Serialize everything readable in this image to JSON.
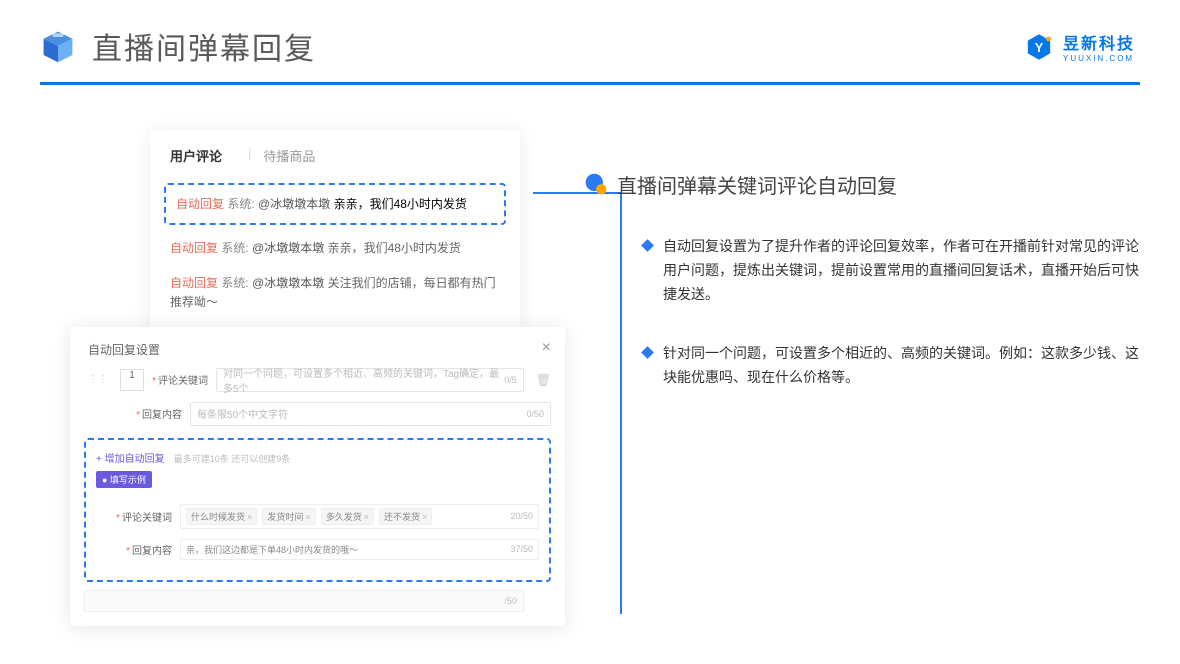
{
  "header": {
    "title": "直播间弹幕回复",
    "brand_cn": "昱新科技",
    "brand_en": "YUUXIN.COM"
  },
  "card1": {
    "tab_active": "用户评论",
    "tab_inactive": "待播商品",
    "highlighted_comment": "自动回复 系统: @冰墩墩本墩 亲亲，我们48小时内发货",
    "auto_label": "自动回复",
    "sys_label": "系统:",
    "name1": "@冰墩墩本墩",
    "text1": "亲亲，我们48小时内发货",
    "name2": "@冰墩墩本墩",
    "text2": "关注我们的店铺，每日都有热门推荐呦～"
  },
  "card2": {
    "title": "自动回复设置",
    "num": "1",
    "label1": "评论关键词",
    "placeholder1": "对同一个问题，可设置多个相近、高频的关键词，Tag确定，最多5个",
    "counter1": "0/5",
    "label2": "回复内容",
    "placeholder2": "每条限50个中文字符",
    "counter2": "0/50",
    "add_link": "+ 增加自动回复",
    "add_hint": "最多可建10条 还可以创建9条",
    "example_badge": "● 填写示例",
    "ex_label1": "评论关键词",
    "tag1": "什么时候发货",
    "tag2": "发货时间",
    "tag3": "多久发货",
    "tag4": "还不发货",
    "ex_counter1": "20/50",
    "ex_label2": "回复内容",
    "ex_value2": "亲，我们这边都是下单48小时内发货的哦～",
    "ex_counter2": "37/50",
    "gray_counter": "/50"
  },
  "right": {
    "section_title": "直播间弹幕关键词评论自动回复",
    "bullet1": "自动回复设置为了提升作者的评论回复效率，作者可在开播前针对常见的评论用户问题，提炼出关键词，提前设置常用的直播间回复话术，直播开始后可快捷发送。",
    "bullet2": "针对同一个问题，可设置多个相近的、高频的关键词。例如：这款多少钱、这块能优惠吗、现在什么价格等。"
  }
}
